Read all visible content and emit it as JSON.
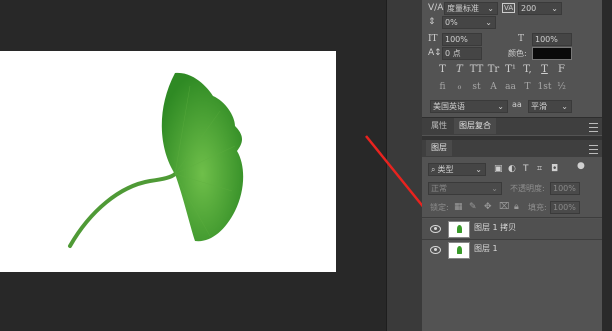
{
  "character": {
    "kerning_method": "度量标准",
    "tracking": "200",
    "vertical_shift": "0%",
    "vertical_scale": "100%",
    "horizontal_scale": "100%",
    "baseline_shift": "0 点",
    "color_label": "颜色:",
    "language": "美国英语",
    "antialias": "平滑",
    "text_style_buttons": [
      "T",
      "T",
      "TT",
      "Tr",
      "T¹",
      "T,",
      "T",
      "F"
    ],
    "opentype_buttons": [
      "fi",
      "ℴ",
      "st",
      "A",
      "aa",
      "T",
      "1st",
      "½"
    ]
  },
  "tabs": {
    "properties": "属性",
    "layer_comps": "图层复合",
    "layers": "图层"
  },
  "layers_panel": {
    "filter_kind": "类型",
    "blend_mode": "正常",
    "opacity_label": "不透明度:",
    "opacity_value": "100%",
    "lock_label": "锁定:",
    "fill_label": "填充:",
    "fill_value": "100%",
    "layers": [
      {
        "name": "图层 1 拷贝",
        "visible": true
      },
      {
        "name": "图层 1",
        "visible": true
      }
    ]
  },
  "colors": {
    "panel_bg": "#535353",
    "workspace_bg": "#282828",
    "annotation_arrow": "#e8231f"
  }
}
